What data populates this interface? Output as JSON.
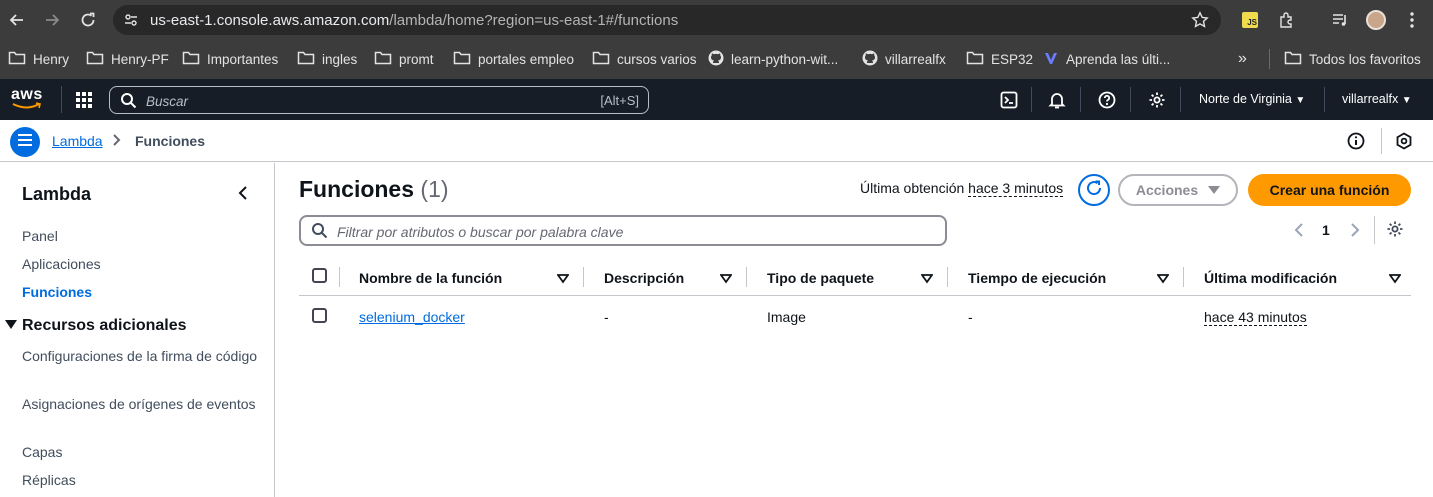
{
  "browser": {
    "url_host": "us-east-1.console.aws.amazon.com",
    "url_path": "/lambda/home?region=us-east-1#/functions",
    "bookmarks": [
      {
        "label": "Henry",
        "icon": "folder-icon"
      },
      {
        "label": "Henry-PF",
        "icon": "folder-icon"
      },
      {
        "label": "Importantes",
        "icon": "folder-icon"
      },
      {
        "label": "ingles",
        "icon": "folder-icon"
      },
      {
        "label": "promt",
        "icon": "folder-icon"
      },
      {
        "label": "portales empleo",
        "icon": "folder-icon"
      },
      {
        "label": "cursos varios",
        "icon": "folder-icon"
      },
      {
        "label": "learn-python-wit...",
        "icon": "github-icon"
      },
      {
        "label": "villarrealfx",
        "icon": "github-icon"
      },
      {
        "label": "ESP32",
        "icon": "folder-icon"
      },
      {
        "label": "Aprenda las últi...",
        "icon": "site-icon"
      }
    ],
    "bookmarks_overflow": "»",
    "all_bookmarks": "Todos los favoritos",
    "extension_js_label": "JS"
  },
  "aws_header": {
    "logo_text": "aws",
    "search_placeholder": "Buscar",
    "search_shortcut": "[Alt+S]",
    "region": "Norte de Virginia",
    "account": "villarrealfx"
  },
  "breadcrumb": {
    "root": "Lambda",
    "current": "Funciones"
  },
  "sidebar": {
    "title": "Lambda",
    "items": [
      {
        "label": "Panel",
        "active": false
      },
      {
        "label": "Aplicaciones",
        "active": false
      },
      {
        "label": "Funciones",
        "active": true
      }
    ],
    "section_title": "Recursos adicionales",
    "section_items": [
      {
        "label": "Configuraciones de la firma de código"
      },
      {
        "label": "Asignaciones de orígenes de eventos"
      },
      {
        "label": "Capas"
      },
      {
        "label": "Réplicas"
      }
    ]
  },
  "main": {
    "title": "Funciones",
    "count": "(1)",
    "last_fetch_label": "Última obtención",
    "last_fetch_value": "hace 3 minutos",
    "actions_label": "Acciones",
    "create_label": "Crear una función",
    "filter_placeholder": "Filtrar por atributos o buscar por palabra clave",
    "page": "1"
  },
  "table": {
    "columns": [
      "Nombre de la función",
      "Descripción",
      "Tipo de paquete",
      "Tiempo de ejecución",
      "Última modificación"
    ],
    "rows": [
      {
        "name": "selenium_docker",
        "description": "-",
        "package_type": "Image",
        "runtime": "-",
        "last_modified": "hace 43 minutos"
      }
    ]
  },
  "colors": {
    "accent": "#006ce0",
    "primary_button": "#ff9900",
    "aws_header_bg": "#161d26",
    "browser_chrome_bg": "#3c3c3c"
  }
}
